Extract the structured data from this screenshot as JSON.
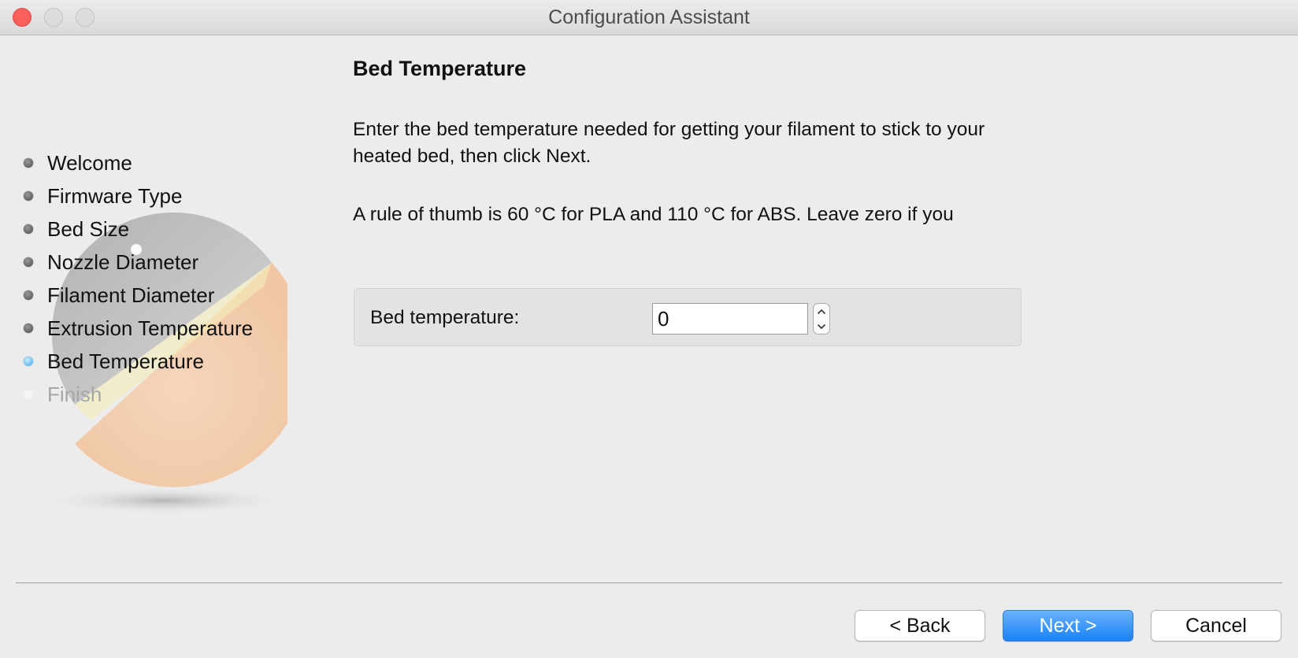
{
  "window": {
    "title": "Configuration Assistant"
  },
  "sidebar": {
    "steps": [
      {
        "label": "Welcome",
        "state": "done"
      },
      {
        "label": "Firmware Type",
        "state": "done"
      },
      {
        "label": "Bed Size",
        "state": "done"
      },
      {
        "label": "Nozzle Diameter",
        "state": "done"
      },
      {
        "label": "Filament Diameter",
        "state": "done"
      },
      {
        "label": "Extrusion Temperature",
        "state": "done"
      },
      {
        "label": "Bed Temperature",
        "state": "current"
      },
      {
        "label": "Finish",
        "state": "future"
      }
    ]
  },
  "page": {
    "title": "Bed Temperature",
    "description_1": "Enter the bed temperature needed for getting your filament to stick to your heated bed, then click Next.",
    "description_2": "A rule of thumb is 60 °C for PLA and 110 °C for ABS. Leave zero if you",
    "field": {
      "label": "Bed temperature:",
      "value": "0"
    }
  },
  "buttons": {
    "back": "< Back",
    "next": "Next >",
    "cancel": "Cancel"
  },
  "colors": {
    "accent": "#1a82f8",
    "current_step": "#3ea9e6",
    "close_button": "#fc605c"
  }
}
